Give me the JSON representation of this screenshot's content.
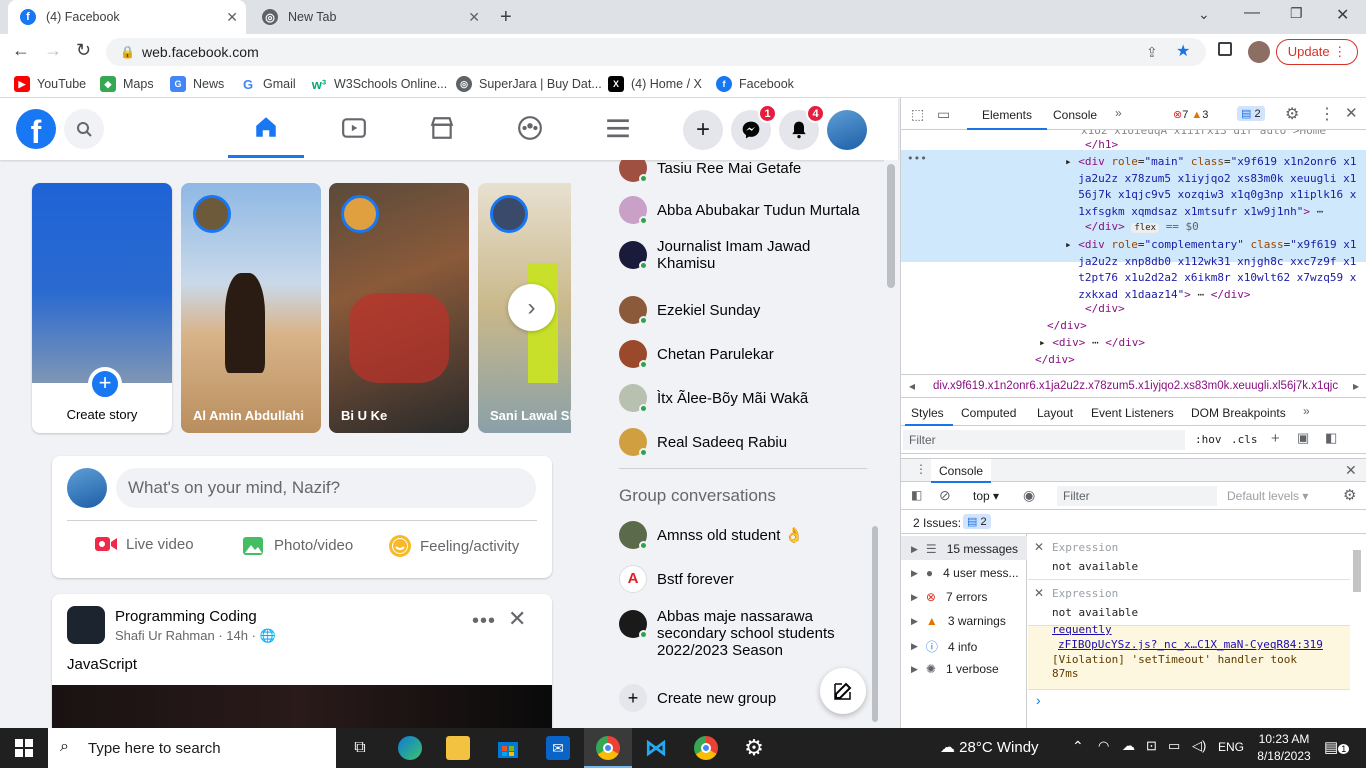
{
  "browser": {
    "tabs": [
      {
        "title": "(4) Facebook",
        "active": true
      },
      {
        "title": "New Tab",
        "active": false
      }
    ],
    "url": "web.facebook.com",
    "update_label": "Update",
    "bookmarks": [
      "YouTube",
      "Maps",
      "News",
      "Gmail",
      "W3Schools Online...",
      "SuperJara | Buy Dat...",
      "(4) Home / X",
      "Facebook"
    ]
  },
  "facebook": {
    "header": {
      "messenger_badge": "1",
      "notifications_badge": "4"
    },
    "stories": [
      {
        "label": "Create story"
      },
      {
        "label": "Al Amin Abdullahi"
      },
      {
        "label": "Bi U Ke"
      },
      {
        "label": "Sani Lawal Slo"
      }
    ],
    "composer": {
      "placeholder": "What's on your mind, Nazif?",
      "actions": [
        "Live video",
        "Photo/video",
        "Feeling/activity"
      ]
    },
    "post": {
      "group": "Programming Coding",
      "author": "Shafi Ur Rahman",
      "time": "14h",
      "text": "JavaScript"
    },
    "contacts": [
      "Tasiu Ree Mai Getafe",
      "Abba Abubakar Tudun Murtala",
      "Journalist Imam Jawad Khamisu",
      "Ezekiel Sunday",
      "Chetan Parulekar",
      "Ìtx Ãlee-Bõy Mãi Wakã",
      "Real Sadeeq Rabiu"
    ],
    "group_conversations_title": "Group conversations",
    "groups": [
      "Amnss old student 👌",
      "Bstf forever",
      "Abbas maje nassarawa secondary school students 2022/2023 Season"
    ],
    "create_group": "Create new group"
  },
  "devtools": {
    "tabs": [
      "Elements",
      "Console"
    ],
    "errors": "7",
    "warnings": "3",
    "issues": "2",
    "breadcrumb": "div.x9f619.x1n2onr6.x1ja2u2z.x78zum5.x1iyjqo2.xs83m0k.xeuugli.xl56j7k.x1qjc",
    "styles_tabs": [
      "Styles",
      "Computed",
      "Layout",
      "Event Listeners",
      "DOM Breakpoints"
    ],
    "filter_placeholder": "Filter",
    "hov": ":hov",
    "cls": ".cls",
    "console_title": "Console",
    "context": "top",
    "console_filter": "Filter",
    "levels": "Default levels",
    "issues_label": "2 Issues:",
    "issues_count": "2",
    "sidebar": [
      "15 messages",
      "4 user mess...",
      "7 errors",
      "3 warnings",
      "4 info",
      "1 verbose"
    ],
    "expressions": [
      {
        "label": "Expression",
        "value": "not available"
      },
      {
        "label": "Expression",
        "value": "not available"
      }
    ],
    "log_link": "zFIBOpUcYSz.js?_nc_x…C1X_maN-CyeqR84:319",
    "log_text": "[Violation] 'setTimeout' handler took 87ms",
    "log_partial": "requently"
  },
  "taskbar": {
    "search_placeholder": "Type here to search",
    "weather": "28°C  Windy",
    "lang": "ENG",
    "time": "10:23 AM",
    "date": "8/18/2023",
    "notif": "1"
  }
}
